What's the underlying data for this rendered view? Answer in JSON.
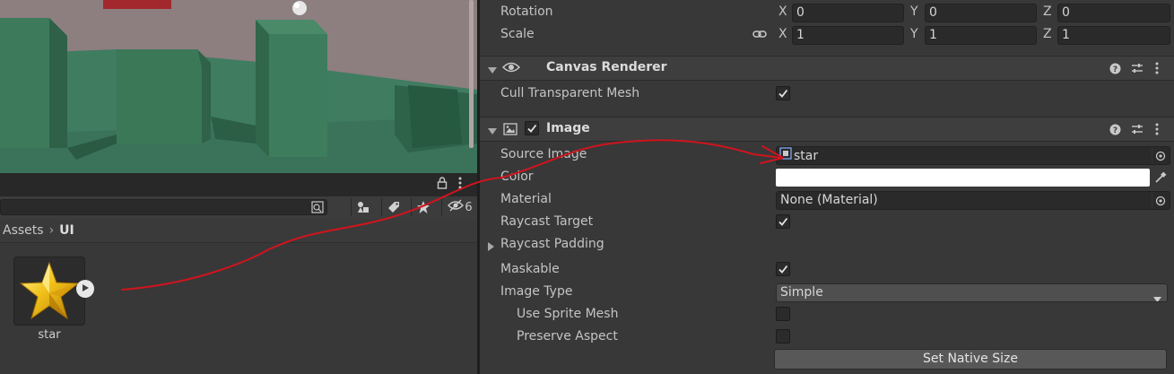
{
  "project": {
    "badge_count": "6",
    "breadcrumb": [
      "Assets",
      "UI"
    ],
    "asset": {
      "name": "star"
    }
  },
  "transform": {
    "rotation": {
      "label": "Rotation",
      "x": "0",
      "y": "0",
      "z": "0"
    },
    "scale": {
      "label": "Scale",
      "x": "1",
      "y": "1",
      "z": "1"
    },
    "axis": {
      "x": "X",
      "y": "Y",
      "z": "Z"
    }
  },
  "canvas_renderer": {
    "title": "Canvas Renderer",
    "cull_label": "Cull Transparent Mesh",
    "cull_checked": true
  },
  "image": {
    "title": "Image",
    "enabled": true,
    "source_image_label": "Source Image",
    "source_image_value": "star",
    "color_label": "Color",
    "color_value": "#ffffff",
    "material_label": "Material",
    "material_value": "None (Material)",
    "raycast_target_label": "Raycast Target",
    "raycast_target_checked": true,
    "raycast_padding_label": "Raycast Padding",
    "maskable_label": "Maskable",
    "maskable_checked": true,
    "image_type_label": "Image Type",
    "image_type_value": "Simple",
    "use_sprite_mesh_label": "Use Sprite Mesh",
    "use_sprite_mesh_checked": false,
    "preserve_aspect_label": "Preserve Aspect",
    "preserve_aspect_checked": false,
    "set_native_size_label": "Set Native Size"
  },
  "colors": {
    "annotation": "#d0141e",
    "scene_bg": "#8a7b7d",
    "scene_green": "#3e7a5c"
  }
}
